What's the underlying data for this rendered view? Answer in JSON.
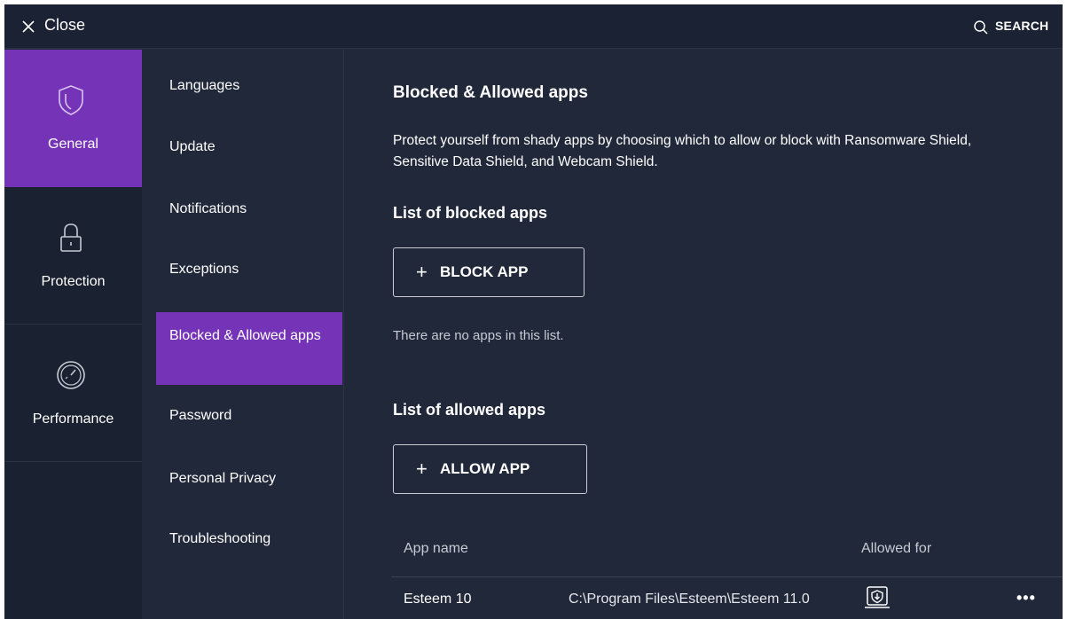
{
  "topbar": {
    "close_label": "Close",
    "search_label": "SEARCH"
  },
  "categories": [
    {
      "label": "General",
      "icon": "shield-icon",
      "active": true
    },
    {
      "label": "Protection",
      "icon": "lock-icon",
      "active": false
    },
    {
      "label": "Performance",
      "icon": "speedometer-icon",
      "active": false
    }
  ],
  "subnav": [
    {
      "label": "Languages"
    },
    {
      "label": "Update"
    },
    {
      "label": "Notifications"
    },
    {
      "label": "Exceptions"
    },
    {
      "label": "Blocked & Allowed apps",
      "active": true
    },
    {
      "label": "Password"
    },
    {
      "label": "Personal Privacy"
    },
    {
      "label": "Troubleshooting"
    }
  ],
  "main": {
    "title": "Blocked & Allowed apps",
    "description": "Protect yourself from shady apps by choosing which to allow or block with Ransomware Shield, Sensitive Data Shield, and Webcam Shield.",
    "blocked_heading": "List of blocked apps",
    "block_button": "BLOCK APP",
    "blocked_empty": "There are no apps in this list.",
    "allowed_heading": "List of allowed apps",
    "allow_button": "ALLOW APP",
    "table": {
      "col_app_name": "App name",
      "col_allowed_for": "Allowed for",
      "rows": [
        {
          "name": "Esteem 10",
          "path": "C:\\Program Files\\Esteem\\Esteem 11.0",
          "allowed_icon": "ransomware-shield-icon"
        }
      ]
    }
  },
  "colors": {
    "accent": "#7534b8",
    "background": "#20283a",
    "sidebar": "#1a2131"
  }
}
